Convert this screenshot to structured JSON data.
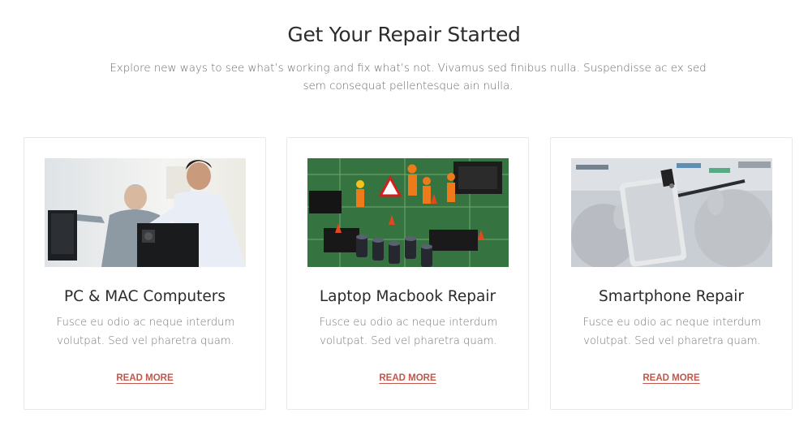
{
  "section": {
    "title": "Get Your Repair Started",
    "intro": "Explore new ways to see what’s working and fix what’s not. Vivamus sed finibus nulla. Suspendisse ac ex sed sem consequat pellentesque ain nulla."
  },
  "cards": [
    {
      "title": "PC & MAC Computers",
      "text": "Fusce eu odio ac neque interdum volutpat. Sed vel pharetra quam.",
      "link_label": "READ MORE",
      "image": "computer-repair-photo"
    },
    {
      "title": "Laptop Macbook Repair",
      "text": "Fusce eu odio ac neque interdum volutpat. Sed vel pharetra quam.",
      "link_label": "READ MORE",
      "image": "circuit-board-workers-photo"
    },
    {
      "title": "Smartphone Repair",
      "text": "Fusce eu odio ac neque interdum volutpat. Sed vel pharetra quam.",
      "link_label": "READ MORE",
      "image": "smartphone-disassembly-photo"
    }
  ],
  "colors": {
    "link": "#c0574a",
    "heading": "#2b2b2b",
    "body_text": "#777777",
    "card_border": "#e8e8e8"
  }
}
